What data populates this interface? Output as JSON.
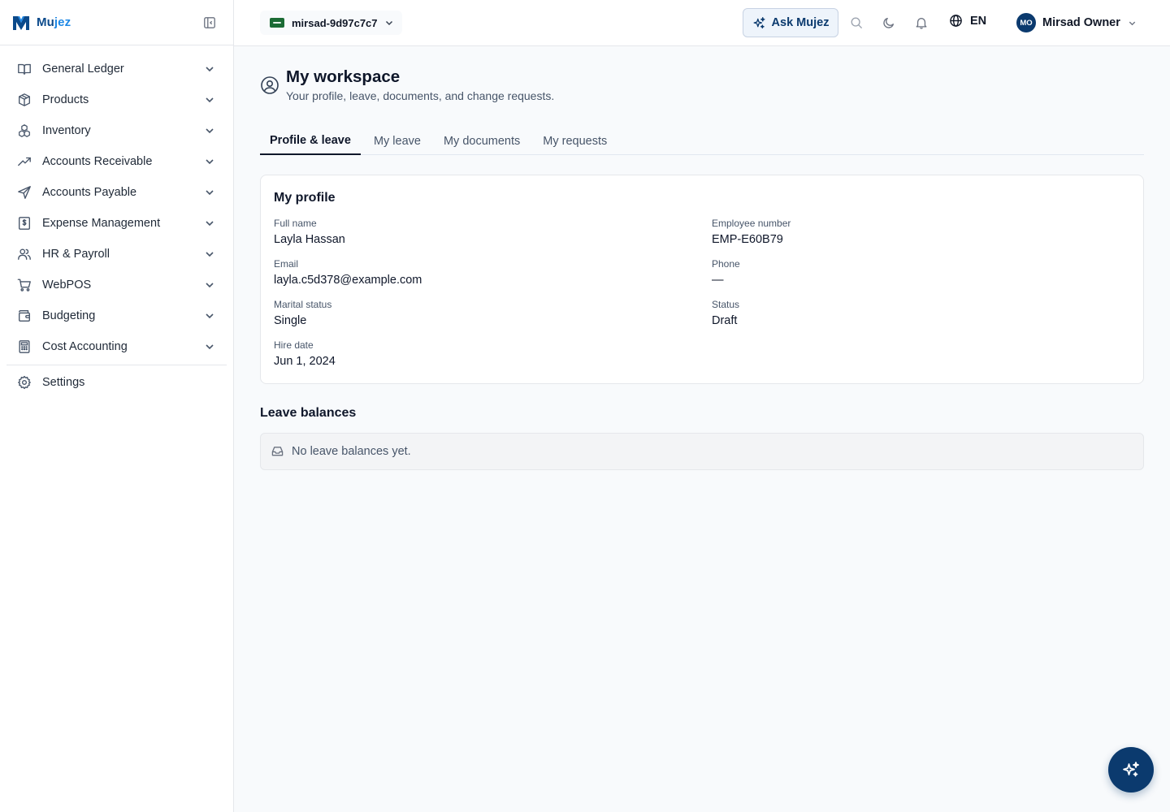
{
  "brand": {
    "name_part1": "Mu",
    "name_part2": "jez",
    "logo_icon": "mujez-logo-icon"
  },
  "sidebar": {
    "items": [
      {
        "label": "General Ledger",
        "icon": "book-icon"
      },
      {
        "label": "Products",
        "icon": "box-icon"
      },
      {
        "label": "Inventory",
        "icon": "boxes-icon"
      },
      {
        "label": "Accounts Receivable",
        "icon": "trending-up-icon"
      },
      {
        "label": "Accounts Payable",
        "icon": "send-icon"
      },
      {
        "label": "Expense Management",
        "icon": "receipt-icon"
      },
      {
        "label": "HR & Payroll",
        "icon": "users-icon"
      },
      {
        "label": "WebPOS",
        "icon": "cart-icon"
      },
      {
        "label": "Budgeting",
        "icon": "wallet-icon"
      },
      {
        "label": "Cost Accounting",
        "icon": "calculator-icon"
      }
    ],
    "settings_label": "Settings"
  },
  "topbar": {
    "workspace": "mirsad-9d97c7c7",
    "ask_label": "Ask Mujez",
    "language": "EN",
    "user_initials": "MO",
    "user_name": "Mirsad Owner"
  },
  "page": {
    "title": "My workspace",
    "subtitle": "Your profile, leave, documents, and change requests."
  },
  "tabs": [
    {
      "label": "Profile & leave",
      "active": true
    },
    {
      "label": "My leave",
      "active": false
    },
    {
      "label": "My documents",
      "active": false
    },
    {
      "label": "My requests",
      "active": false
    }
  ],
  "profile": {
    "title": "My profile",
    "fields": {
      "full_name": {
        "label": "Full name",
        "value": "Layla Hassan"
      },
      "employee_number": {
        "label": "Employee number",
        "value": "EMP-E60B79"
      },
      "email": {
        "label": "Email",
        "value": "layla.c5d378@example.com"
      },
      "phone": {
        "label": "Phone",
        "value": "—"
      },
      "marital_status": {
        "label": "Marital status",
        "value": "Single"
      },
      "status": {
        "label": "Status",
        "value": "Draft"
      },
      "hire_date": {
        "label": "Hire date",
        "value": "Jun 1, 2024"
      }
    }
  },
  "leave_balances": {
    "title": "Leave balances",
    "empty_text": "No leave balances yet."
  },
  "colors": {
    "primary": "#0b3a6e",
    "brand_light": "#1e88e5",
    "border": "#e5e7eb"
  }
}
